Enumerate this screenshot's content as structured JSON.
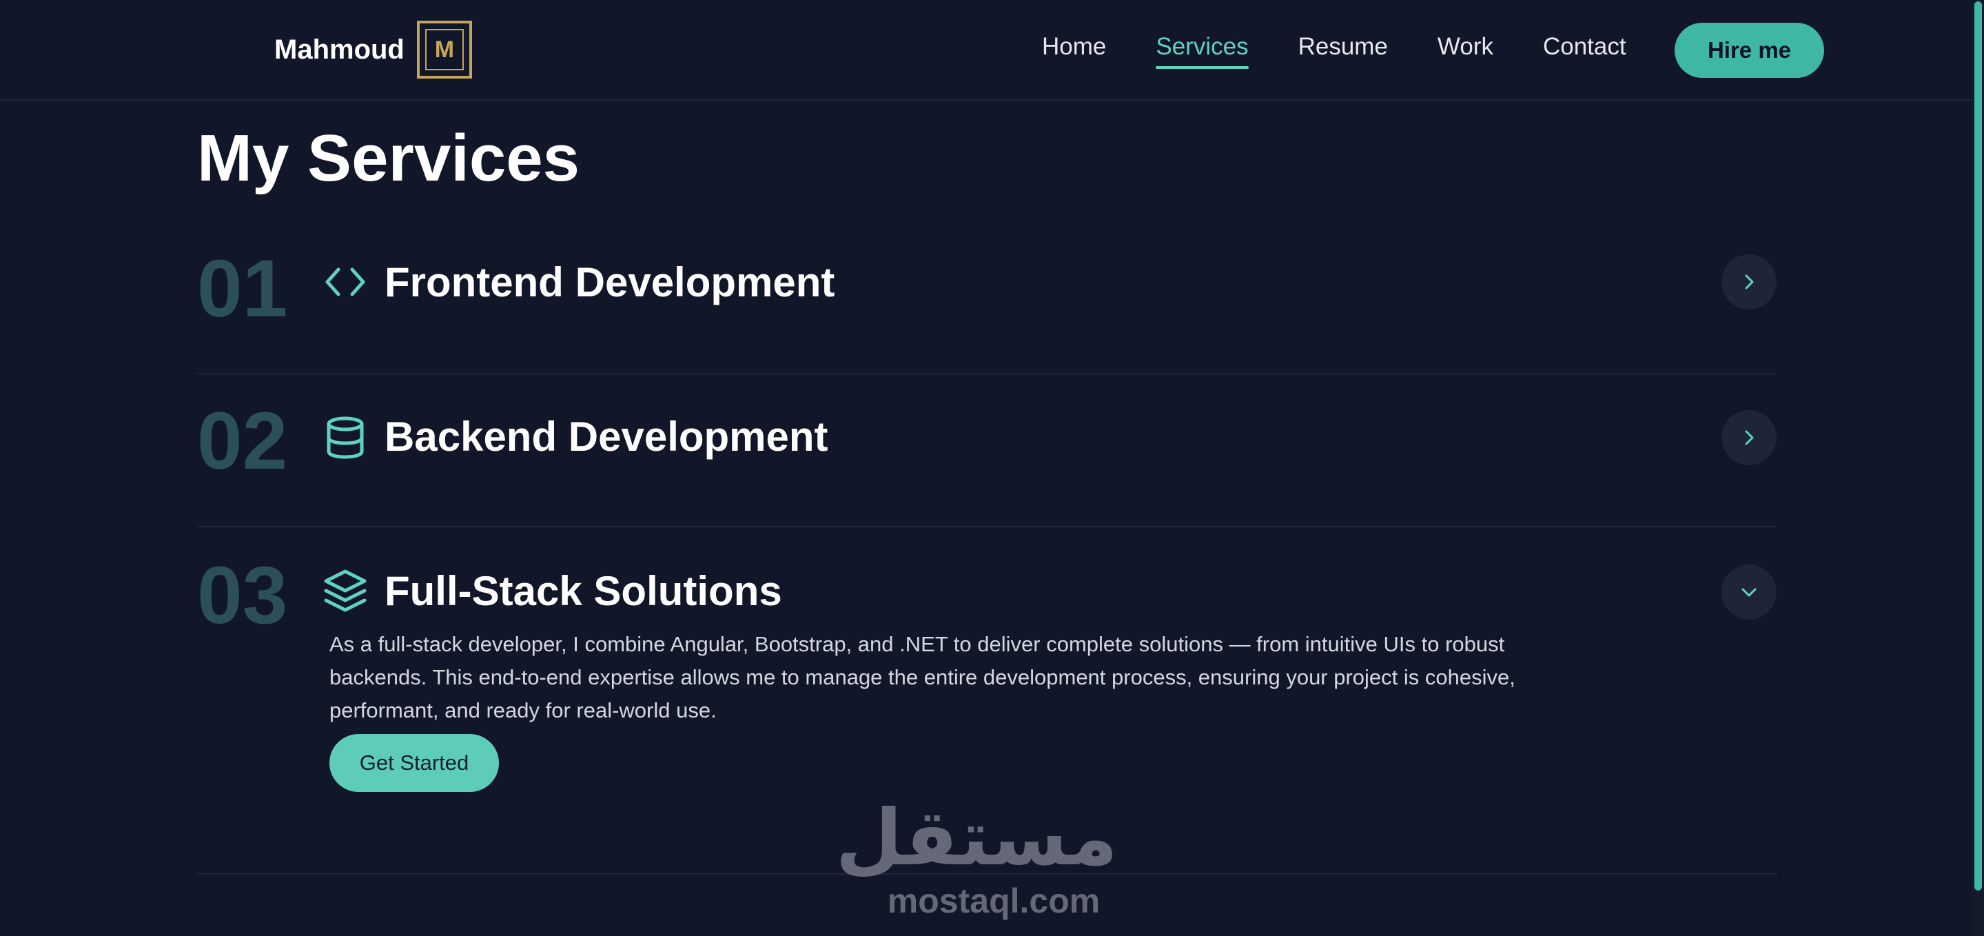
{
  "header": {
    "brand_name": "Mahmoud",
    "brand_mark": "M",
    "nav": [
      {
        "label": "Home",
        "active": false
      },
      {
        "label": "Services",
        "active": true
      },
      {
        "label": "Resume",
        "active": false
      },
      {
        "label": "Work",
        "active": false
      },
      {
        "label": "Contact",
        "active": false
      }
    ],
    "hire_label": "Hire me"
  },
  "main": {
    "title": "My Services",
    "services": [
      {
        "number": "01",
        "icon": "code-icon",
        "title": "Frontend Development",
        "expanded": false
      },
      {
        "number": "02",
        "icon": "database-icon",
        "title": "Backend Development",
        "expanded": false
      },
      {
        "number": "03",
        "icon": "layers-icon",
        "title": "Full-Stack Solutions",
        "expanded": true,
        "description": "As a full-stack developer, I combine Angular, Bootstrap, and .NET to deliver complete solutions — from intuitive UIs to robust backends. This end-to-end expertise allows me to manage the entire development process, ensuring your project is cohesive, performant, and ready for real-world use.",
        "cta_label": "Get Started"
      }
    ]
  },
  "watermark": {
    "logo_text": "مستقل",
    "domain": "mostaql.com"
  },
  "colors": {
    "background": "#111628",
    "accent": "#3fb8a3",
    "accent_light": "#5fd3bf",
    "number": "#2b5058",
    "gold": "#c6a55a"
  }
}
